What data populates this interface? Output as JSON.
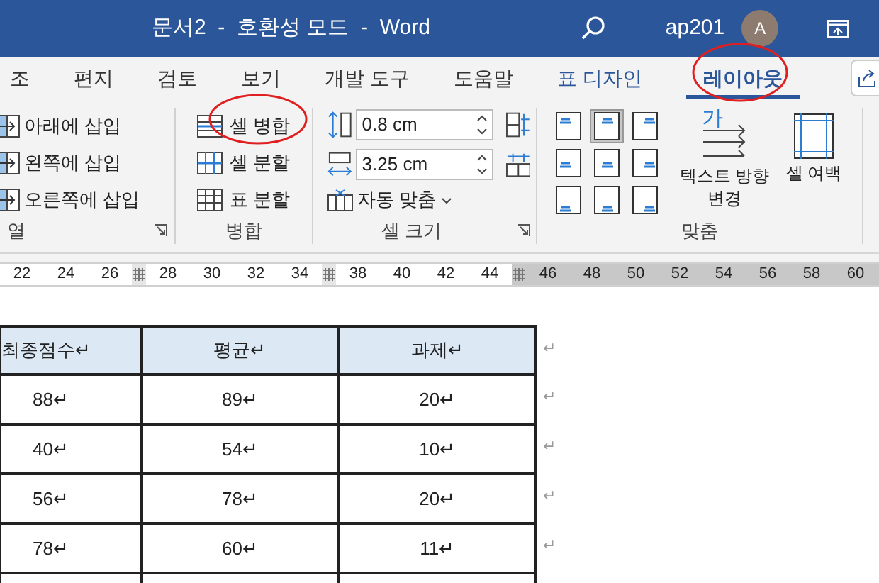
{
  "window": {
    "title": "문서2  -  호환성 모드  -  Word",
    "user": "ap201",
    "avatar": "A"
  },
  "tabs": [
    {
      "label": "조",
      "selected": false,
      "kind": "normal"
    },
    {
      "label": "편지",
      "selected": false,
      "kind": "normal"
    },
    {
      "label": "검토",
      "selected": false,
      "kind": "normal"
    },
    {
      "label": "보기",
      "selected": false,
      "kind": "normal"
    },
    {
      "label": "개발 도구",
      "selected": false,
      "kind": "normal"
    },
    {
      "label": "도움말",
      "selected": false,
      "kind": "normal"
    },
    {
      "label": "표 디자인",
      "selected": false,
      "kind": "contextual"
    },
    {
      "label": "레이아웃",
      "selected": true,
      "kind": "contextual"
    }
  ],
  "ribbon": {
    "columns_group": {
      "label": "열",
      "items": [
        "아래에 삽입",
        "왼쪽에 삽입",
        "오른쪽에 삽입"
      ]
    },
    "merge_group": {
      "label": "병합",
      "items": [
        "셀 병합",
        "셀 분할",
        "표 분할"
      ]
    },
    "cell_size_group": {
      "label": "셀 크기",
      "height": "0.8 cm",
      "width": "3.25 cm",
      "autofit": "자동 맞춤"
    },
    "alignment_group": {
      "label": "맞춤",
      "alignments": [
        {
          "selected": false
        },
        {
          "selected": true
        },
        {
          "selected": false
        },
        {
          "selected": false
        },
        {
          "selected": false
        },
        {
          "selected": false
        },
        {
          "selected": false
        },
        {
          "selected": false
        },
        {
          "selected": false
        }
      ],
      "text_direction": {
        "icon_text": "가",
        "label": "텍스트 방향 변경"
      },
      "cell_margins": "셀 여백"
    }
  },
  "ruler": [
    {
      "kind": "number",
      "label": "22",
      "shaded": false
    },
    {
      "kind": "number",
      "label": "24",
      "shaded": false
    },
    {
      "kind": "number",
      "label": "26",
      "shaded": false
    },
    {
      "kind": "marker",
      "shaded": false
    },
    {
      "kind": "number",
      "label": "28",
      "shaded": false
    },
    {
      "kind": "number",
      "label": "30",
      "shaded": false
    },
    {
      "kind": "number",
      "label": "32",
      "shaded": false
    },
    {
      "kind": "number",
      "label": "34",
      "shaded": false
    },
    {
      "kind": "marker",
      "shaded": false
    },
    {
      "kind": "number",
      "label": "38",
      "shaded": false
    },
    {
      "kind": "number",
      "label": "40",
      "shaded": false
    },
    {
      "kind": "number",
      "label": "42",
      "shaded": false
    },
    {
      "kind": "number",
      "label": "44",
      "shaded": false
    },
    {
      "kind": "marker",
      "shaded": true
    },
    {
      "kind": "number",
      "label": "46",
      "shaded": true
    },
    {
      "kind": "number",
      "label": "48",
      "shaded": true
    },
    {
      "kind": "number",
      "label": "50",
      "shaded": true
    },
    {
      "kind": "number",
      "label": "52",
      "shaded": true
    },
    {
      "kind": "number",
      "label": "54",
      "shaded": true
    },
    {
      "kind": "number",
      "label": "56",
      "shaded": true
    },
    {
      "kind": "number",
      "label": "58",
      "shaded": true
    },
    {
      "kind": "number",
      "label": "60",
      "shaded": true
    }
  ],
  "table": {
    "columns": [
      "최종점수↵",
      "평균↵",
      "과제↵"
    ],
    "rows": [
      {
        "cells": [
          "88↵",
          "89↵",
          "20↵"
        ],
        "end_mark": "↵"
      },
      {
        "cells": [
          "40↵",
          "54↵",
          "10↵"
        ],
        "end_mark": "↵"
      },
      {
        "cells": [
          "56↵",
          "78↵",
          "20↵"
        ],
        "end_mark": "↵"
      },
      {
        "cells": [
          "78↵",
          "60↵",
          "11↵"
        ],
        "end_mark": "↵"
      }
    ],
    "header_end_mark": "↵"
  }
}
